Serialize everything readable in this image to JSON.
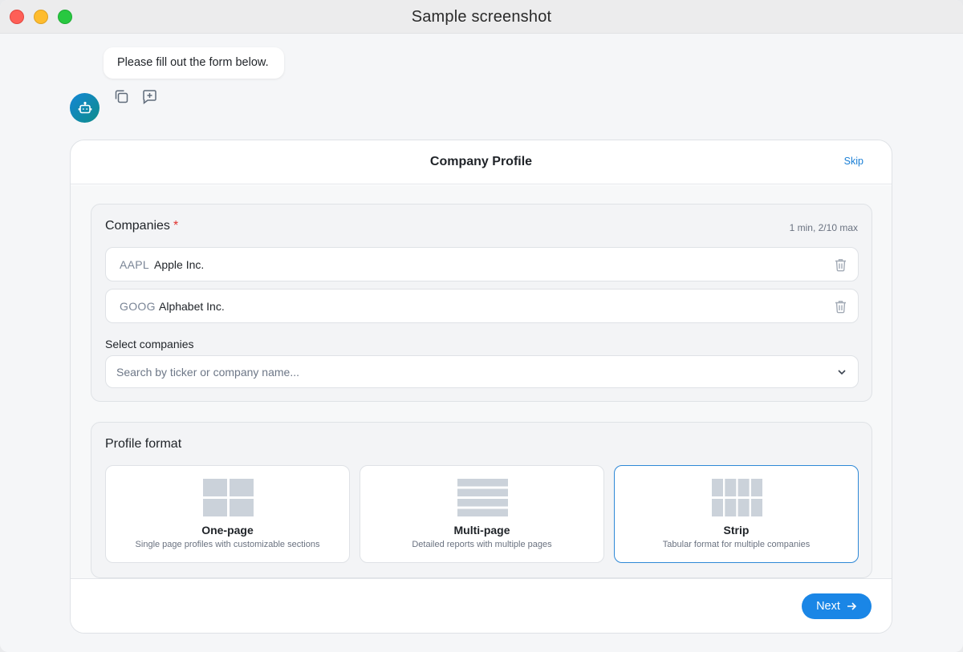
{
  "window": {
    "title": "Sample screenshot"
  },
  "chat": {
    "message": "Please fill out the form below.",
    "actions": [
      {
        "icon": "copy-icon"
      },
      {
        "icon": "add-comment-icon"
      }
    ],
    "avatar_icon": "bot-icon"
  },
  "form": {
    "title": "Company Profile",
    "skip_label": "Skip",
    "companies": {
      "title": "Companies",
      "required_mark": "*",
      "limit": "1 min, 2/10 max",
      "items": [
        {
          "ticker": "AAPL",
          "name": "Apple Inc."
        },
        {
          "ticker": "GOOG",
          "name": "Alphabet Inc."
        }
      ],
      "select_label": "Select companies",
      "search_placeholder": "Search by ticker or company name...",
      "search_value": ""
    },
    "profile_format": {
      "title": "Profile format",
      "selected": "Strip",
      "options": [
        {
          "title": "One-page",
          "description": "Single page profiles with customizable sections",
          "icon": "grid-2x2-icon"
        },
        {
          "title": "Multi-page",
          "description": "Detailed reports with multiple pages",
          "icon": "stacked-rows-icon"
        },
        {
          "title": "Strip",
          "description": "Tabular format for multiple companies",
          "icon": "grid-4x2-icon"
        }
      ]
    },
    "next_label": "Next"
  },
  "colors": {
    "accent": "#1a86e6",
    "selected_border": "#2e88d6",
    "required": "#e0322f",
    "icon_gray": "#cbd2da"
  }
}
